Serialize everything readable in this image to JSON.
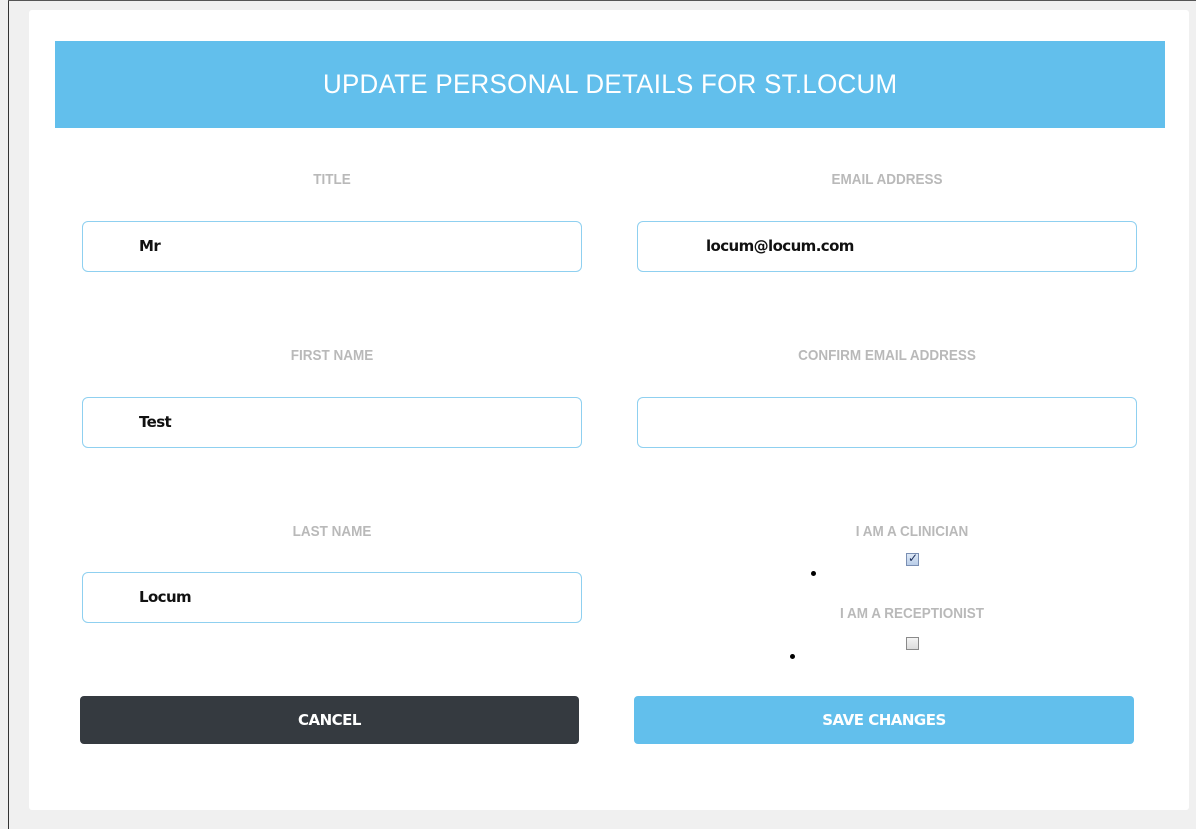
{
  "header": {
    "title": "UPDATE PERSONAL DETAILS FOR ST.LOCUM"
  },
  "form": {
    "title": {
      "label": "TITLE",
      "value": "Mr"
    },
    "email": {
      "label": "EMAIL ADDRESS",
      "value": "locum@locum.com"
    },
    "first_name": {
      "label": "FIRST NAME",
      "value": "Test"
    },
    "confirm_email": {
      "label": "CONFIRM EMAIL ADDRESS",
      "value": ""
    },
    "last_name": {
      "label": "LAST NAME",
      "value": "Locum"
    },
    "clinician": {
      "label": "I AM A CLINICIAN",
      "checked": true
    },
    "receptionist": {
      "label": "I AM A RECEPTIONIST",
      "checked": false
    }
  },
  "buttons": {
    "cancel": "CANCEL",
    "save": "SAVE CHANGES"
  },
  "colors": {
    "accent": "#62bfec",
    "cancel_bg": "#353a40",
    "label": "#b9b9b9",
    "field_border": "#8fd0f0"
  }
}
